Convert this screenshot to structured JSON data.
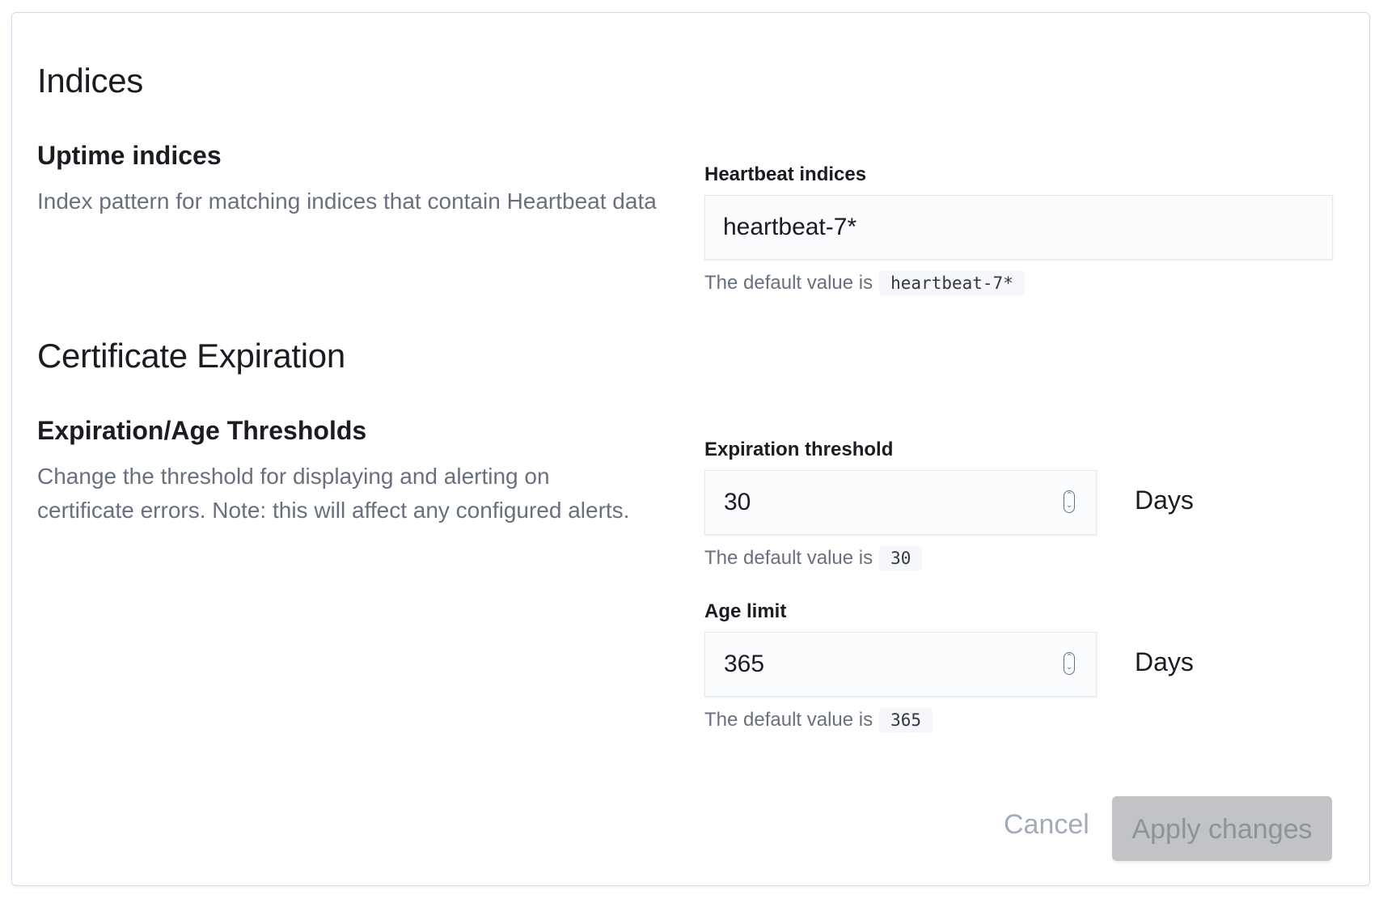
{
  "indices_section": {
    "title": "Indices",
    "group_title": "Uptime indices",
    "group_description": "Index pattern for matching indices that contain Heartbeat data",
    "field": {
      "label": "Heartbeat indices",
      "value": "heartbeat-7*",
      "help_prefix": "The default value is",
      "default_value": "heartbeat-7*"
    }
  },
  "certificate_section": {
    "title": "Certificate Expiration",
    "group_title": "Expiration/Age Thresholds",
    "group_description": "Change the threshold for displaying and alerting on certificate errors. Note: this will affect any configured alerts.",
    "expiration_field": {
      "label": "Expiration threshold",
      "value": "30",
      "unit": "Days",
      "help_prefix": "The default value is",
      "default_value": "30"
    },
    "age_field": {
      "label": "Age limit",
      "value": "365",
      "unit": "Days",
      "help_prefix": "The default value is",
      "default_value": "365"
    }
  },
  "actions": {
    "cancel_label": "Cancel",
    "apply_label": "Apply changes"
  },
  "colors": {
    "text_primary": "#1a1c21",
    "text_subdued": "#69707d",
    "button_disabled_bg": "#c2c3c6",
    "button_disabled_text": "#8e9299",
    "cancel_disabled_text": "#a2abba",
    "panel_border": "#d3dae6"
  },
  "icons": {
    "spinner": "number-spinner-icon"
  }
}
